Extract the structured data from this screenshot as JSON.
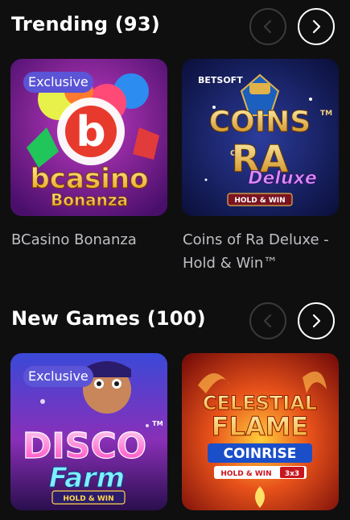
{
  "sections": [
    {
      "title": "Trending (93)",
      "games": [
        {
          "title": "BCasino Bonanza",
          "badge": "Exclusive",
          "logo_top": "b",
          "logo_mid": "bcasino",
          "logo_bottom": "Bonanza"
        },
        {
          "title": "Coins of Ra Deluxe - Hold & Win™",
          "studio": "BETSOFT",
          "logo_top": "COINS",
          "logo_of": "OF",
          "logo_mid": "RA",
          "logo_sub": "Deluxe",
          "logo_bottom": "HOLD & WIN",
          "logo_tm": "TM"
        }
      ]
    },
    {
      "title": "New Games (100)",
      "games": [
        {
          "title": "",
          "badge": "Exclusive",
          "logo_top": "DISCO",
          "logo_mid": "Farm",
          "logo_bottom": "HOLD & WIN",
          "logo_tm": "TM"
        },
        {
          "title": "",
          "logo_top": "CELESTIAL",
          "logo_mid": "FLAME",
          "logo_sub": "COINRISE",
          "logo_bottom": "HOLD & WIN",
          "logo_extra": "3x3"
        }
      ]
    }
  ],
  "icons": {
    "prev": "chevron-left-icon",
    "next": "chevron-right-icon"
  },
  "colors": {
    "background": "#0f0f10",
    "badge": "#5b54d6",
    "title_text": "#ffffff",
    "game_text": "#bfbfc4",
    "nav_disabled": "#3a3a3d"
  }
}
